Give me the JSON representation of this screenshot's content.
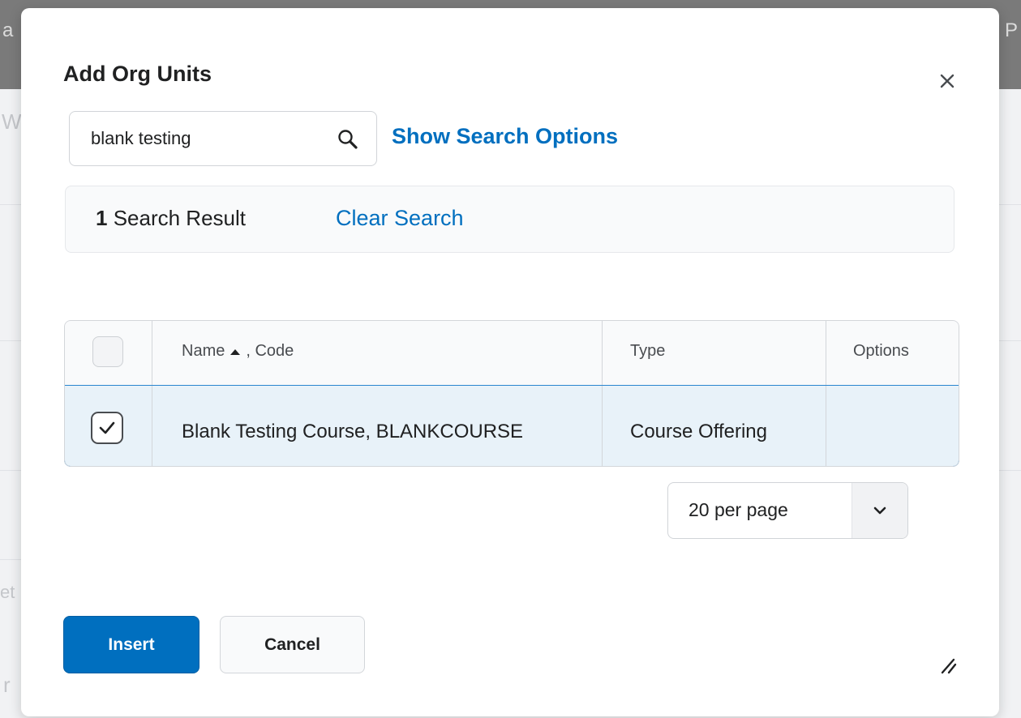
{
  "background": {
    "top_left_fragment": "a",
    "top_right_fragment": "P",
    "left_fragments": [
      "W",
      "et",
      "r"
    ]
  },
  "dialog": {
    "title": "Add Org Units",
    "close_icon": "close-icon"
  },
  "search": {
    "value": "blank testing",
    "search_icon": "search-icon",
    "show_options_label": "Show Search Options"
  },
  "results": {
    "count": "1",
    "count_label": "Search Result",
    "clear_label": "Clear Search"
  },
  "table": {
    "headers": {
      "name_label": "Name",
      "sort_icon": "sort-ascending-icon",
      "code_label": ", Code",
      "type": "Type",
      "options": "Options"
    },
    "rows": [
      {
        "name_code": "Blank Testing Course, BLANKCOURSE",
        "type": "Course Offering",
        "options": "",
        "checked": true
      }
    ]
  },
  "pager": {
    "selected": "20 per page",
    "icon": "chevron-down-icon"
  },
  "footer": {
    "insert_label": "Insert",
    "cancel_label": "Cancel",
    "resize_icon": "resize-handle-icon"
  },
  "colors": {
    "link": "#006fbf",
    "primary_button": "#006fbf",
    "selected_row": "#e8f2f9",
    "selected_row_border": "#2a86cf"
  }
}
